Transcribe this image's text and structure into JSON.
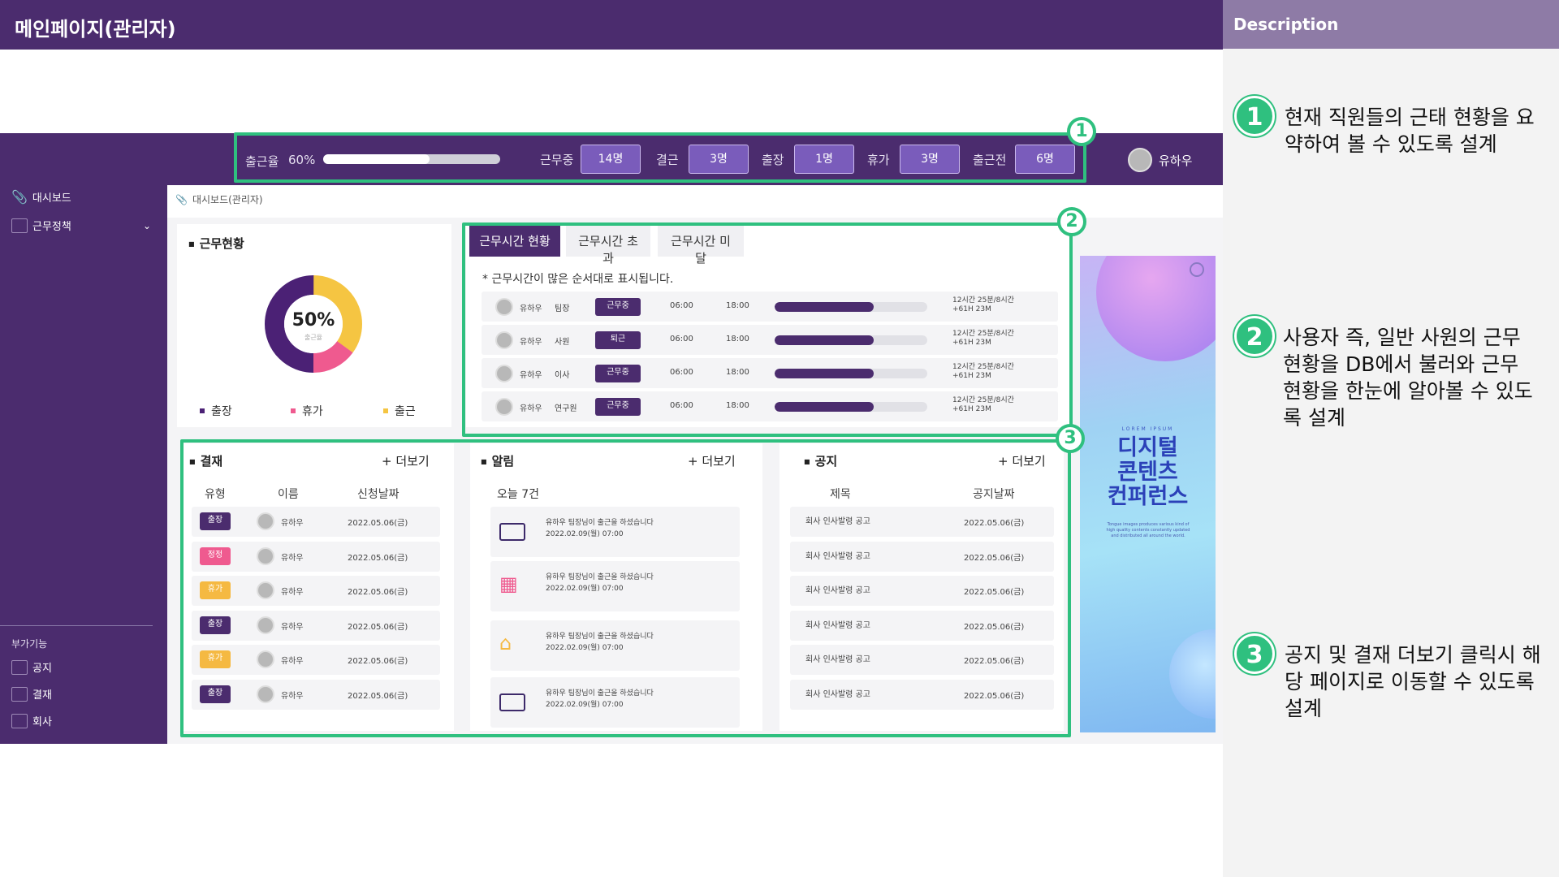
{
  "header": {
    "title": "메인페이지(관리자)",
    "description_title": "Description"
  },
  "summary": {
    "attendance_label": "출근율",
    "attendance_value": "60%",
    "attendance_fraction": 0.6,
    "items": [
      {
        "label": "근무중",
        "value": "14명"
      },
      {
        "label": "결근",
        "value": "3명"
      },
      {
        "label": "출장",
        "value": "1명"
      },
      {
        "label": "휴가",
        "value": "3명"
      },
      {
        "label": "출근전",
        "value": "6명"
      }
    ],
    "user_name": "유하우"
  },
  "sidebar": {
    "items": [
      {
        "label": "대시보드",
        "icon": "paperclip-icon"
      },
      {
        "label": "근무정책",
        "icon": "presentation-icon"
      }
    ],
    "extra_title": "부가기능",
    "extra_items": [
      {
        "label": "공지",
        "icon": "megaphone-icon"
      },
      {
        "label": "결재",
        "icon": "clipboard-icon"
      },
      {
        "label": "회사",
        "icon": "building-icon"
      }
    ]
  },
  "breadcrumb": "대시보드(관리자)",
  "work_status": {
    "title": "근무현황",
    "center_value": "50%",
    "center_label": "출근율",
    "segments": [
      {
        "name": "출장",
        "pct": 50,
        "color": "#4b2175"
      },
      {
        "name": "휴가",
        "pct": 15,
        "color": "#ef5a8f"
      },
      {
        "name": "출근",
        "pct": 35,
        "color": "#f5c542"
      }
    ],
    "legend": [
      {
        "label": "출장",
        "color": "#4b2175"
      },
      {
        "label": "휴가",
        "color": "#ef5a8f"
      },
      {
        "label": "출근",
        "color": "#f5c542"
      }
    ]
  },
  "work_time": {
    "tabs": [
      "근무시간 현황",
      "근무시간 초과",
      "근무시간 미달"
    ],
    "note": "* 근무시간이 많은 순서대로 표시됩니다.",
    "rows": [
      {
        "name": "유하우",
        "position": "팀장",
        "status": "근무중",
        "start": "06:00",
        "end": "18:00",
        "progress": 0.65,
        "hours": "12시간 25분/8시간",
        "extra": "+61H 23M"
      },
      {
        "name": "유하우",
        "position": "사원",
        "status": "퇴근",
        "start": "06:00",
        "end": "18:00",
        "progress": 0.65,
        "hours": "12시간 25분/8시간",
        "extra": "+61H 23M"
      },
      {
        "name": "유하우",
        "position": "이사",
        "status": "근무중",
        "start": "06:00",
        "end": "18:00",
        "progress": 0.65,
        "hours": "12시간 25분/8시간",
        "extra": "+61H 23M"
      },
      {
        "name": "유하우",
        "position": "연구원",
        "status": "근무중",
        "start": "06:00",
        "end": "18:00",
        "progress": 0.65,
        "hours": "12시간 25분/8시간",
        "extra": "+61H 23M"
      }
    ]
  },
  "approval": {
    "title": "결재",
    "more": "+ 더보기",
    "headers": [
      "유형",
      "이름",
      "신청날짜"
    ],
    "rows": [
      {
        "type": "출장",
        "color": "#4b2c6e",
        "name": "유하우",
        "date": "2022.05.06(금)"
      },
      {
        "type": "정정",
        "color": "#ef5a8f",
        "name": "유하우",
        "date": "2022.05.06(금)"
      },
      {
        "type": "휴가",
        "color": "#f5b942",
        "name": "유하우",
        "date": "2022.05.06(금)"
      },
      {
        "type": "출장",
        "color": "#4b2c6e",
        "name": "유하우",
        "date": "2022.05.06(금)"
      },
      {
        "type": "휴가",
        "color": "#f5b942",
        "name": "유하우",
        "date": "2022.05.06(금)"
      },
      {
        "type": "출장",
        "color": "#4b2c6e",
        "name": "유하우",
        "date": "2022.05.06(금)"
      }
    ]
  },
  "alerts": {
    "title": "알림",
    "more": "+ 더보기",
    "count_label": "오늘 7건",
    "items": [
      {
        "icon": "briefcase-icon",
        "text": "유하우 팀장님이 출근을 하셨습니다",
        "time": "2022.02.09(월) 07:00"
      },
      {
        "icon": "building-icon",
        "text": "유하우 팀장님이 출근을 하셨습니다",
        "time": "2022.02.09(월) 07:00"
      },
      {
        "icon": "home-icon",
        "text": "유하우 팀장님이 출근을 하셨습니다",
        "time": "2022.02.09(월) 07:00"
      },
      {
        "icon": "briefcase-icon",
        "text": "유하우 팀장님이 출근을 하셨습니다",
        "time": "2022.02.09(월) 07:00"
      }
    ]
  },
  "notice": {
    "title": "공지",
    "more": "+ 더보기",
    "headers": [
      "제목",
      "공지날짜"
    ],
    "rows": [
      {
        "title": "회사 인사발령 공고",
        "date": "2022.05.06(금)"
      },
      {
        "title": "회사 인사발령 공고",
        "date": "2022.05.06(금)"
      },
      {
        "title": "회사 인사발령 공고",
        "date": "2022.05.06(금)"
      },
      {
        "title": "회사 인사발령 공고",
        "date": "2022.05.06(금)"
      },
      {
        "title": "회사 인사발령 공고",
        "date": "2022.05.06(금)"
      },
      {
        "title": "회사 인사발령 공고",
        "date": "2022.05.06(금)"
      }
    ]
  },
  "banner": {
    "top": "LOREM IPSUM",
    "title_lines": [
      "디지털",
      "콘텐츠",
      "컨퍼런스"
    ],
    "caption": "Tongue images produces various kind of high quality contents constantly updated and distributed all around the world."
  },
  "annotations": [
    "1",
    "2",
    "3"
  ],
  "description": [
    {
      "num": "1",
      "text": "현재 직원들의 근태 현황을 요약하여 볼 수 있도록 설계"
    },
    {
      "num": "2",
      "text": "사용자 즉, 일반 사원의 근무 현황을 DB에서 불러와 근무 현황을 한눈에 알아볼 수 있도록 설계"
    },
    {
      "num": "3",
      "text": "공지 및 결재 더보기 클릭시 해당 페이지로 이동할 수 있도록 설계"
    }
  ]
}
